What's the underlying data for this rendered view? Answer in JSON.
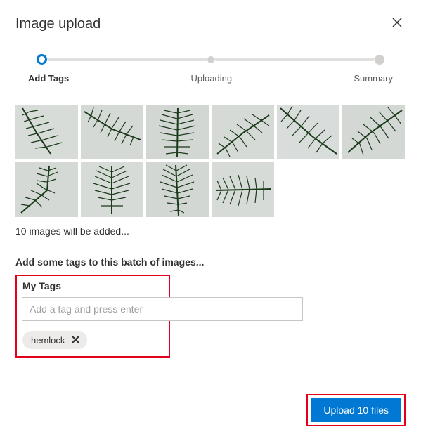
{
  "dialog": {
    "title": "Image upload",
    "close_label": "Close"
  },
  "steps": {
    "s1": "Add Tags",
    "s2": "Uploading",
    "s3": "Summary"
  },
  "status": "10 images will be added...",
  "prompt": "Add some tags to this batch of images...",
  "tags": {
    "section_label": "My Tags",
    "input_placeholder": "Add a tag and press enter",
    "chip0": "hemlock"
  },
  "actions": {
    "upload": "Upload 10 files"
  },
  "colors": {
    "accent": "#0078d4",
    "highlight_border": "#e3001b"
  }
}
